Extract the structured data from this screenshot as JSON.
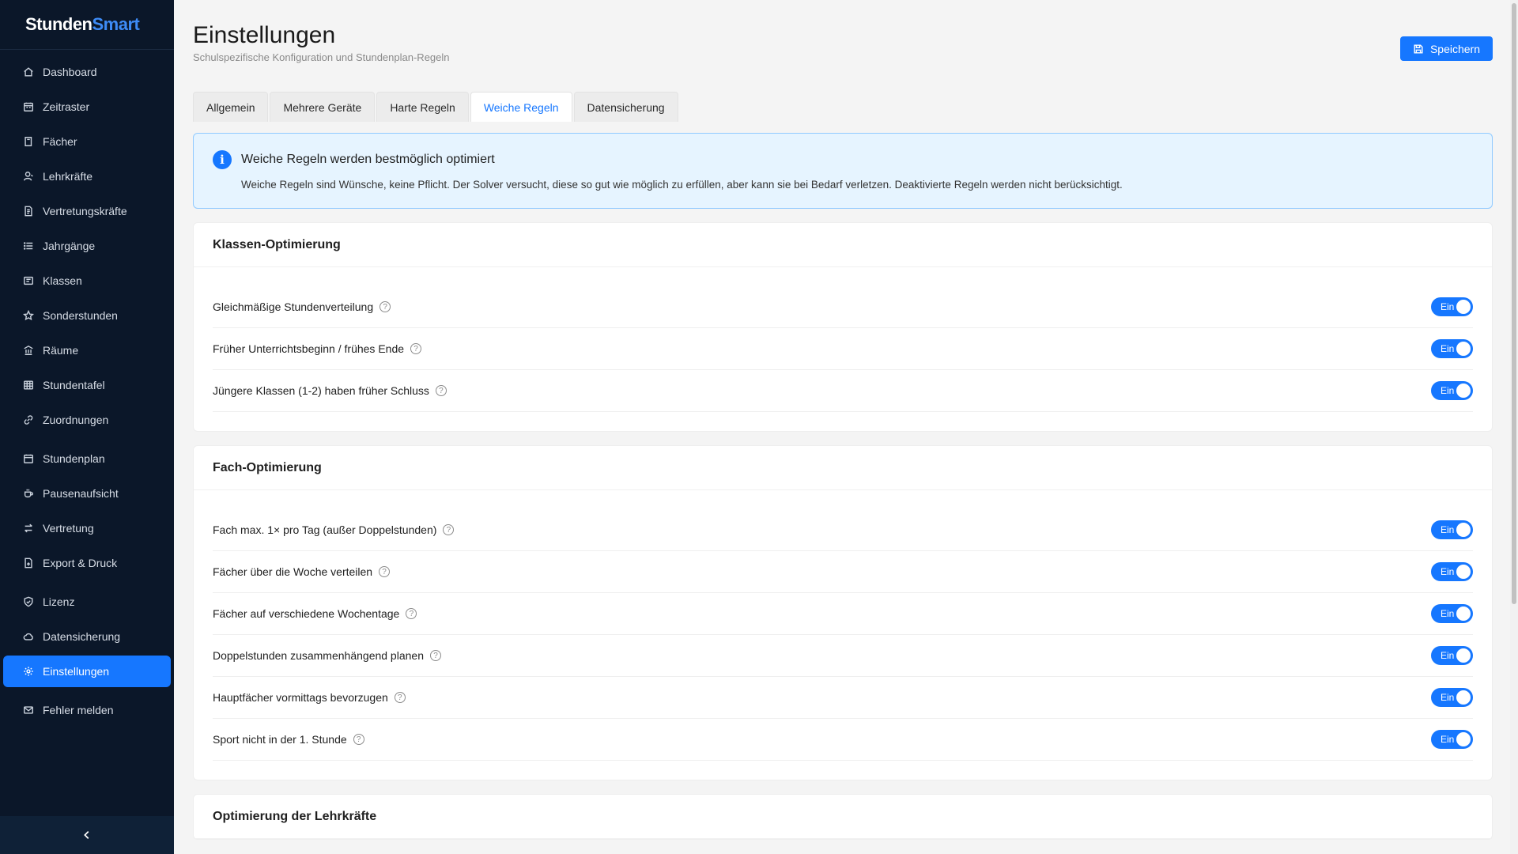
{
  "brand": {
    "part1": "Stunden",
    "part2": "Smart"
  },
  "sidebar": {
    "items": [
      {
        "label": "Dashboard",
        "icon": "home-icon"
      },
      {
        "label": "Zeitraster",
        "icon": "calendar-grid-icon"
      },
      {
        "label": "Fächer",
        "icon": "book-icon"
      },
      {
        "label": "Lehrkräfte",
        "icon": "user-icon"
      },
      {
        "label": "Vertretungskräfte",
        "icon": "document-icon"
      },
      {
        "label": "Jahrgänge",
        "icon": "list-icon"
      },
      {
        "label": "Klassen",
        "icon": "classroom-icon"
      },
      {
        "label": "Sonderstunden",
        "icon": "star-icon"
      },
      {
        "label": "Räume",
        "icon": "building-icon"
      },
      {
        "label": "Stundentafel",
        "icon": "table-icon"
      },
      {
        "label": "Zuordnungen",
        "icon": "link-icon"
      },
      {
        "label": "Stundenplan",
        "icon": "calendar-icon"
      },
      {
        "label": "Pausenaufsicht",
        "icon": "coffee-icon"
      },
      {
        "label": "Vertretung",
        "icon": "swap-icon"
      },
      {
        "label": "Export & Druck",
        "icon": "file-export-icon"
      },
      {
        "label": "Lizenz",
        "icon": "shield-icon"
      },
      {
        "label": "Datensicherung",
        "icon": "cloud-icon"
      },
      {
        "label": "Einstellungen",
        "icon": "gear-icon",
        "active": true
      },
      {
        "label": "Fehler melden",
        "icon": "mail-icon"
      }
    ]
  },
  "header": {
    "title": "Einstellungen",
    "subtitle": "Schulspezifische Konfiguration und Stundenplan-Regeln",
    "save_label": "Speichern"
  },
  "tabs": [
    {
      "label": "Allgemein"
    },
    {
      "label": "Mehrere Geräte"
    },
    {
      "label": "Harte Regeln"
    },
    {
      "label": "Weiche Regeln",
      "active": true
    },
    {
      "label": "Datensicherung"
    }
  ],
  "info": {
    "title": "Weiche Regeln werden bestmöglich optimiert",
    "text": "Weiche Regeln sind Wünsche, keine Pflicht. Der Solver versucht, diese so gut wie möglich zu erfüllen, aber kann sie bei Bedarf verletzen. Deaktivierte Regeln werden nicht berücksichtigt."
  },
  "sections": [
    {
      "title": "Klassen-Optimierung",
      "rules": [
        {
          "label": "Gleichmäßige Stundenverteilung",
          "state": "Ein"
        },
        {
          "label": "Früher Unterrichtsbeginn / frühes Ende",
          "state": "Ein"
        },
        {
          "label": "Jüngere Klassen (1-2) haben früher Schluss",
          "state": "Ein"
        }
      ]
    },
    {
      "title": "Fach-Optimierung",
      "rules": [
        {
          "label": "Fach max. 1× pro Tag (außer Doppelstunden)",
          "state": "Ein"
        },
        {
          "label": "Fächer über die Woche verteilen",
          "state": "Ein"
        },
        {
          "label": "Fächer auf verschiedene Wochentage",
          "state": "Ein"
        },
        {
          "label": "Doppelstunden zusammenhängend planen",
          "state": "Ein"
        },
        {
          "label": "Hauptfächer vormittags bevorzugen",
          "state": "Ein"
        },
        {
          "label": "Sport nicht in der 1. Stunde",
          "state": "Ein"
        }
      ]
    },
    {
      "title": "Optimierung der Lehrkräfte",
      "rules": []
    }
  ],
  "colors": {
    "accent": "#1677ff",
    "sidebar_bg": "#0b1729",
    "info_bg": "#e6f4ff"
  }
}
